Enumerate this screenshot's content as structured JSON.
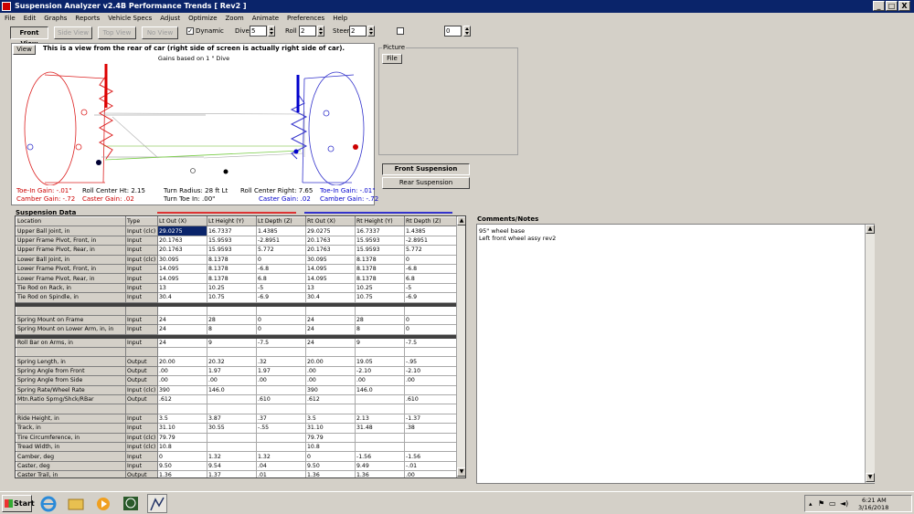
{
  "window": {
    "title": "Suspension Analyzer v2.4B   Performance Trends  [ Rev2 ]",
    "minimize": "_",
    "maximize": "□",
    "close": "X"
  },
  "menu": [
    "File",
    "Edit",
    "Graphs",
    "Reports",
    "Vehicle Specs",
    "Adjust",
    "Optimize",
    "Zoom",
    "Animate",
    "Preferences",
    "Help"
  ],
  "toolbar": {
    "tabs": [
      "Front View",
      "Side View",
      "Top View",
      "No View"
    ],
    "dynamic_label": "Dynamic",
    "dive_label": "Dive",
    "dive_value": "5",
    "roll_label": "Roll",
    "roll_value": "2",
    "steer_label": "Steer",
    "steer_value": "2",
    "extra_value": "0"
  },
  "view": {
    "button": "View",
    "heading": "This is a view from the rear of car (right side of screen is actually right side of car).",
    "subheading": "Gains based on 1 \" Dive",
    "stats": {
      "left_toe": "Toe-In Gain: -.01\"",
      "left_camber": "Camber Gain: -.72",
      "roll_center_ht": "Roll Center Ht: 2.15",
      "caster_left": "Caster Gain: .02",
      "turn_radius": "Turn Radius: 28 ft Lt",
      "turn_toe": "Turn Toe In: .00\"",
      "roll_center_right": "Roll Center Right: 7.65",
      "caster_right": "Caster Gain: .02",
      "right_toe": "Toe-In Gain: -.01\"",
      "right_camber": "Camber Gain: -.72"
    }
  },
  "picture": {
    "label": "Picture",
    "file_button": "File"
  },
  "suspension_buttons": {
    "front": "Front Suspension",
    "rear": "Rear Suspension"
  },
  "suspension_data": {
    "title": "Suspension Data",
    "columns": [
      "Location",
      "Type",
      "Lt Out (X)",
      "Lt Height (Y)",
      "Lt Depth (Z)",
      "Rt Out (X)",
      "Rt Height (Y)",
      "Rt Depth (Z)"
    ],
    "rows": [
      [
        "Upper Ball Joint, in",
        "Input (clc)",
        "29.0275",
        "16.7337",
        "1.4385",
        "29.0275",
        "16.7337",
        "1.4385"
      ],
      [
        "Upper Frame Pivot, Front, in",
        "Input",
        "20.1763",
        "15.9593",
        "-2.8951",
        "20.1763",
        "15.9593",
        "-2.8951"
      ],
      [
        "Upper Frame Pivot, Rear, in",
        "Input",
        "20.1763",
        "15.9593",
        "5.772",
        "20.1763",
        "15.9593",
        "5.772"
      ],
      [
        "Lower Ball Joint, in",
        "Input (clc)",
        "30.095",
        "8.1378",
        "0",
        "30.095",
        "8.1378",
        "0"
      ],
      [
        "Lower Frame Pivot, Front, in",
        "Input",
        "14.095",
        "8.1378",
        "-6.8",
        "14.095",
        "8.1378",
        "-6.8"
      ],
      [
        "Lower Frame Pivot, Rear, in",
        "Input",
        "14.095",
        "8.1378",
        "6.8",
        "14.095",
        "8.1378",
        "6.8"
      ],
      [
        "Tie Rod on Rack, in",
        "Input",
        "13",
        "10.25",
        "-5",
        "13",
        "10.25",
        "-5"
      ],
      [
        "Tie Rod on Spindle, in",
        "Input",
        "30.4",
        "10.75",
        "-6.9",
        "30.4",
        "10.75",
        "-6.9"
      ],
      "SEP",
      [
        "",
        "",
        "",
        "",
        "",
        "",
        "",
        ""
      ],
      [
        "Spring Mount on Frame",
        "Input",
        "24",
        "28",
        "0",
        "24",
        "28",
        "0"
      ],
      [
        "Spring Mount on Lower Arm, in, in",
        "Input",
        "24",
        "8",
        "0",
        "24",
        "8",
        "0"
      ],
      "SEP",
      [
        "Roll Bar on Arms, in",
        "Input",
        "24",
        "9",
        "-7.5",
        "24",
        "9",
        "-7.5"
      ],
      [
        "",
        "",
        "",
        "",
        "",
        "",
        "",
        ""
      ],
      [
        "Spring Length, in",
        "Output",
        "20.00",
        "20.32",
        ".32",
        "20.00",
        "19.05",
        "-.95"
      ],
      [
        "Spring Angle from Front",
        "Output",
        ".00",
        "1.97",
        "1.97",
        ".00",
        "-2.10",
        "-2.10"
      ],
      [
        "Spring Angle from Side",
        "Output",
        ".00",
        ".00",
        ".00",
        ".00",
        ".00",
        ".00"
      ],
      [
        "Spring Rate/Wheel Rate",
        "Input (clc)",
        "390",
        "146.0",
        "",
        "390",
        "146.0",
        ""
      ],
      [
        "Mtn.Ratio Sprng/Shck/RBar",
        "Output",
        ".612",
        "",
        ".610",
        ".612",
        "",
        ".610"
      ],
      [
        "",
        "",
        "",
        "",
        "",
        "",
        "",
        ""
      ],
      [
        "Ride Height, in",
        "Input",
        "3.5",
        "3.87",
        ".37",
        "3.5",
        "2.13",
        "-1.37"
      ],
      [
        "Track, in",
        "Input",
        "31.10",
        "30.55",
        "-.55",
        "31.10",
        "31.48",
        ".38"
      ],
      [
        "Tire Circumference, in",
        "Input (clc)",
        "79.79",
        "",
        "",
        "79.79",
        "",
        ""
      ],
      [
        "Tread Width, in",
        "Input (clc)",
        "10.8",
        "",
        "",
        "10.8",
        "",
        ""
      ],
      [
        "Camber, deg",
        "Input",
        "0",
        "1.32",
        "1.32",
        "0",
        "-1.56",
        "-1.56"
      ],
      [
        "Caster, deg",
        "Input",
        "9.50",
        "9.54",
        ".04",
        "9.50",
        "9.49",
        "-.01"
      ],
      [
        "Caster Trail, in",
        "Output",
        "1.36",
        "1.37",
        ".01",
        "1.36",
        "1.36",
        ".00"
      ]
    ]
  },
  "comments": {
    "label": "Comments/Notes",
    "lines": [
      "95\" wheel base",
      "Left front wheel assy rev2"
    ]
  },
  "taskbar": {
    "start": "Start",
    "time": "6:21 AM",
    "date": "3/16/2018"
  }
}
